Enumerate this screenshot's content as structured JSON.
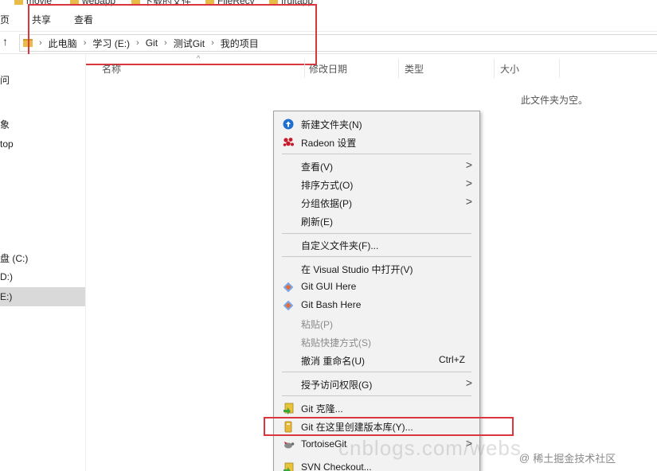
{
  "favorites": [
    "movie",
    "webapp",
    "下载的文件",
    "FileRecv",
    "fruitapp"
  ],
  "ribbon": {
    "tabs": [
      "页",
      "共享",
      "查看"
    ]
  },
  "address": {
    "crumbs": [
      "此电脑",
      "学习 (E:)",
      "Git",
      "测试Git",
      "我的项目"
    ]
  },
  "sidebar": {
    "items": [
      "问",
      "象",
      "top",
      "盘 (C:)",
      "D:)",
      "E:)"
    ]
  },
  "columns": [
    "名称",
    "修改日期",
    "类型",
    "大小"
  ],
  "empty_message": "此文件夹为空。",
  "context_menu": {
    "items": [
      {
        "label": "新建文件夹(N)",
        "icon": "new-folder-icon"
      },
      {
        "label": "Radeon 设置",
        "icon": "radeon-icon"
      },
      {
        "label": "查看(V)",
        "submenu": ">"
      },
      {
        "label": "排序方式(O)",
        "submenu": ">"
      },
      {
        "label": "分组依据(P)",
        "submenu": ">"
      },
      {
        "label": "刷新(E)"
      },
      {
        "label": "自定义文件夹(F)..."
      },
      {
        "label": "在 Visual Studio 中打开(V)"
      },
      {
        "label": "Git GUI Here",
        "icon": "git-icon"
      },
      {
        "label": "Git Bash Here",
        "icon": "git-icon"
      },
      {
        "label": "粘贴(P)",
        "disabled": true
      },
      {
        "label": "粘贴快捷方式(S)",
        "disabled": true
      },
      {
        "label": "撤消 重命名(U)",
        "shortcut": "Ctrl+Z"
      },
      {
        "label": "授予访问权限(G)",
        "submenu": ">"
      },
      {
        "label": "Git 克隆...",
        "icon": "tortoisegit-clone-icon"
      },
      {
        "label": "Git 在这里创建版本库(Y)...",
        "icon": "tortoisegit-repo-icon"
      },
      {
        "label": "TortoiseGit",
        "icon": "tortoisegit-icon",
        "submenu": ">"
      },
      {
        "label": "SVN Checkout...",
        "icon": "svn-checkout-icon"
      }
    ]
  },
  "watermark": {
    "at": "@",
    "text": "稀土掘金技术社区"
  },
  "ghost_text": "cnblogs.com/webs",
  "colors": {
    "highlight": "#d9363e",
    "menu_bg": "#f2f2f2",
    "selected_bg": "#d9d9d9"
  }
}
